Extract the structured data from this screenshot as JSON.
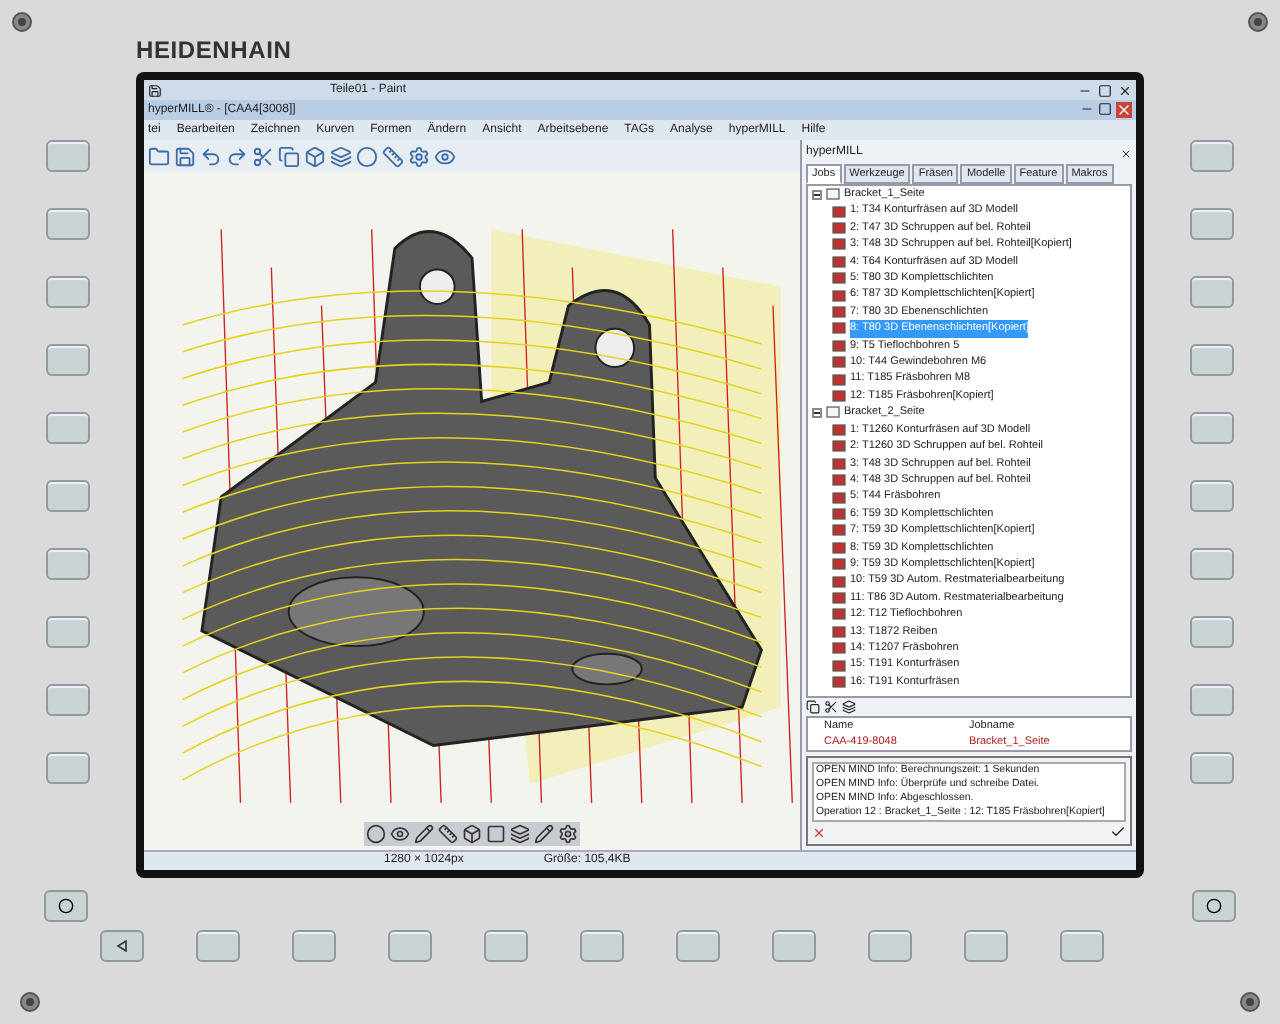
{
  "brand": "HEIDENHAIN",
  "paint_title": "Teile01 - Paint",
  "app_title": "hyperMILL® - [CAA4[3008]]",
  "menu": [
    "tei",
    "Bearbeiten",
    "Zeichnen",
    "Kurven",
    "Formen",
    "Ändern",
    "Ansicht",
    "Arbeitsebene",
    "TAGs",
    "Analyse",
    "hyperMILL",
    "Hilfe"
  ],
  "panel": {
    "title": "hyperMILL",
    "tabs": [
      {
        "label": "Jobs",
        "selected": true
      },
      {
        "label": "Werkzeuge",
        "selected": false
      },
      {
        "label": "Fräsen",
        "selected": false
      },
      {
        "label": "Modelle",
        "selected": false
      },
      {
        "label": "Feature",
        "selected": false
      },
      {
        "label": "Makros",
        "selected": false
      }
    ],
    "tree": [
      {
        "label": "Bracket_1_Seite",
        "selected": false,
        "expanded": true,
        "children": [
          {
            "label": "1: T34 Konturfräsen auf 3D Modell",
            "selected": false
          },
          {
            "label": "2: T47 3D Schruppen auf bel. Rohteil",
            "selected": false
          },
          {
            "label": "3: T48 3D Schruppen auf bel. Rohteil[Kopiert]",
            "selected": false
          },
          {
            "label": "4: T64 Konturfräsen auf 3D Modell",
            "selected": false
          },
          {
            "label": "5: T80 3D Komplettschlichten",
            "selected": false
          },
          {
            "label": "6: T87 3D Komplettschlichten[Kopiert]",
            "selected": false
          },
          {
            "label": "7: T80 3D Ebenenschlichten",
            "selected": false
          },
          {
            "label": "8: T80 3D Ebenenschlichten[Kopiert]",
            "selected": true
          },
          {
            "label": "9: T5 Tieflochbohren 5",
            "selected": false
          },
          {
            "label": "10: T44 Gewindebohren M6",
            "selected": false
          },
          {
            "label": "11: T185 Fräsbohren M8",
            "selected": false
          },
          {
            "label": "12: T185 Fräsbohren[Kopiert]",
            "selected": false
          }
        ]
      },
      {
        "label": "Bracket_2_Seite",
        "selected": false,
        "expanded": true,
        "children": [
          {
            "label": "1: T1260 Konturfräsen auf 3D Modell",
            "selected": false
          },
          {
            "label": "2: T1260 3D Schruppen auf bel. Rohteil",
            "selected": false
          },
          {
            "label": "3: T48 3D Schruppen auf bel. Rohteil",
            "selected": false
          },
          {
            "label": "4: T48 3D Schruppen auf bel. Rohteil",
            "selected": false
          },
          {
            "label": "5: T44 Fräsbohren",
            "selected": false
          },
          {
            "label": "6: T59 3D Komplettschlichten",
            "selected": false
          },
          {
            "label": "7: T59 3D Komplettschlichten[Kopiert]",
            "selected": false
          },
          {
            "label": "8: T59 3D Komplettschlichten",
            "selected": false
          },
          {
            "label": "9: T59 3D Komplettschlichten[Kopiert]",
            "selected": false
          },
          {
            "label": "10: T59 3D Autom. Restmaterialbearbeitung",
            "selected": false
          },
          {
            "label": "11: T86 3D Autom. Restmaterialbearbeitung",
            "selected": false
          },
          {
            "label": "12: T12 Tieflochbohren",
            "selected": false
          },
          {
            "label": "13: T1872 Reiben",
            "selected": false
          },
          {
            "label": "14: T1207 Fräsbohren",
            "selected": false
          },
          {
            "label": "15: T191 Konturfräsen",
            "selected": false
          },
          {
            "label": "16: T191 Konturfräsen",
            "selected": false
          }
        ]
      }
    ],
    "table": {
      "columns": [
        "Name",
        "Jobname"
      ],
      "rows": [
        [
          "CAA-419-8048",
          "Bracket_1_Seite"
        ]
      ]
    }
  },
  "messages": [
    "OPEN MIND Info:  Berechnungszeit: 1 Sekunden",
    "OPEN MIND Info:  Überprüfe und schreibe Datei.",
    "OPEN MIND Info:  Abgeschlossen.",
    "Operation 12 : Bracket_1_Seite : 12: T185 Fräsbohren[Kopiert]"
  ],
  "status_bar": [
    "1280 × 1024px",
    "Größe: 105,4KB"
  ]
}
